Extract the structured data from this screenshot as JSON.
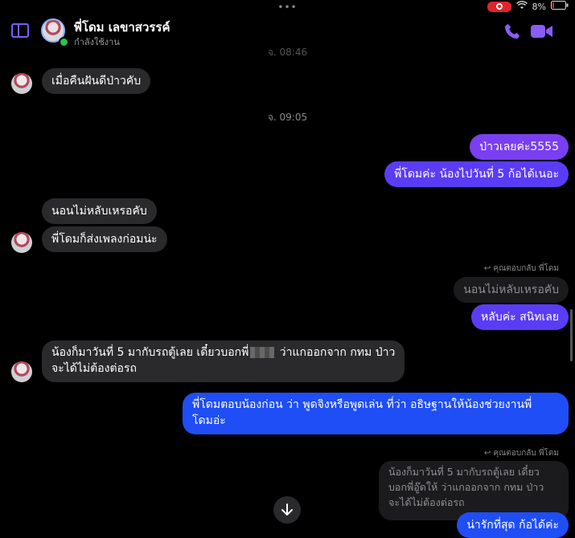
{
  "status_bar": {
    "battery": "8%"
  },
  "header": {
    "contact_name": "พี่โดม เลขาสวรรค์",
    "status": "กำลังใช้งาน"
  },
  "timestamps": {
    "top_cut": "จ. 08:46",
    "mid": "จ. 09:05"
  },
  "messages": {
    "m1": "เมื่อคืนฝันดีป่าวคับ",
    "m2": "ป่าวเลยค่ะ5555",
    "m3": "พี่โดมค่ะ น้องไปวันที่ 5 ก้อได้เนอะ",
    "m4": "นอนไม่หลับเหรอคับ",
    "m5": "พี่โดมก็ส่งเพลงก่อมน่ะ",
    "m6_reply_label": "คุณตอบกลับ พี่โดม",
    "m6_quoted": "นอนไม่หลับเหรอคับ",
    "m6": "หลับค่ะ สนิทเลย",
    "m7_line1_a": "น้องก็มาวันที่ 5 มากับรถตู้เลย เดี๋ยวบอกพี่",
    "m7_line1_b": " ว่าแกออกจาก กทม ป่าว",
    "m7_line2": "จะได้ไม่ต้องต่อรถ",
    "m8_line1": "พี่โดมตอบน้องก่อน ว่า พูดจิงหรือพูดเล่น ที่ว่า อธิษฐานให้น้องช่วยงานพี่",
    "m8_line2": "โดมอ่ะ",
    "m9_reply_label": "คุณตอบกลับ พี่โดม",
    "m9_quoted_line1": "น้องก็มาวันที่ 5 มากับรถตู้เลย เดี๋ยว",
    "m9_quoted_line2": "บอกพี่อู๊ดให้ ว่าแกออกจาก กทม ป่าว",
    "m9_quoted_line3": "จะได้ไม่ต้องต่อรถ",
    "m9": "น่ารักที่สุด ก้อได้ค่ะ"
  },
  "colors": {
    "accent": "#7b5cf5",
    "bubble_in": "#2a2a2c",
    "bubble_out_purple": "#7a3ff0",
    "bubble_out_blue": "#1f4ef6"
  }
}
